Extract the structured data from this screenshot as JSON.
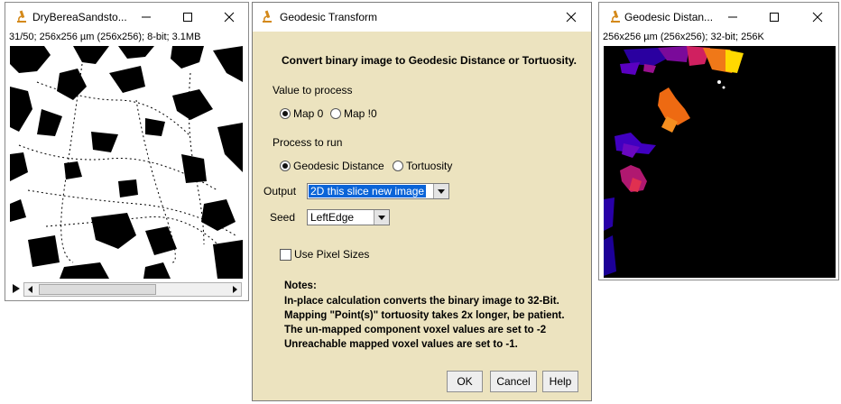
{
  "left_window": {
    "title": "DryBereaSandsto...",
    "info": "31/50; 256x256 µm (256x256); 8-bit; 3.1MB"
  },
  "dialog": {
    "title": "Geodesic Transform",
    "heading": "Convert binary image to Geodesic Distance or Tortuosity.",
    "value_label": "Value to process",
    "value_options": [
      {
        "label": "Map 0",
        "checked": true
      },
      {
        "label": "Map !0",
        "checked": false
      }
    ],
    "process_label": "Process to run",
    "process_options": [
      {
        "label": "Geodesic Distance",
        "checked": true
      },
      {
        "label": "Tortuosity",
        "checked": false
      }
    ],
    "output_label": "Output",
    "output_value": "2D this slice new image",
    "seed_label": "Seed",
    "seed_value": "LeftEdge",
    "pixel_sizes_label": "Use Pixel Sizes",
    "pixel_sizes_checked": false,
    "notes_title": "Notes:",
    "notes_lines": [
      "In-place calculation converts the binary image to 32-Bit.",
      "Mapping \"Point(s)\" tortuosity takes 2x longer, be patient.",
      "The un-mapped component voxel values are set to -2",
      "Unreachable mapped voxel values are set to -1."
    ],
    "buttons": {
      "ok": "OK",
      "cancel": "Cancel",
      "help": "Help"
    }
  },
  "right_window": {
    "title": "Geodesic Distan...",
    "info": "256x256 µm (256x256); 32-bit; 256K"
  },
  "colors": {
    "dialog_bg": "#ece3bf",
    "selection": "#0a64d8",
    "imagej_icon": "#d4891a"
  },
  "icons": [
    "imagej-microscope-icon",
    "minimize-icon",
    "maximize-icon",
    "close-icon",
    "play-icon",
    "scroll-left-icon",
    "scroll-right-icon"
  ]
}
